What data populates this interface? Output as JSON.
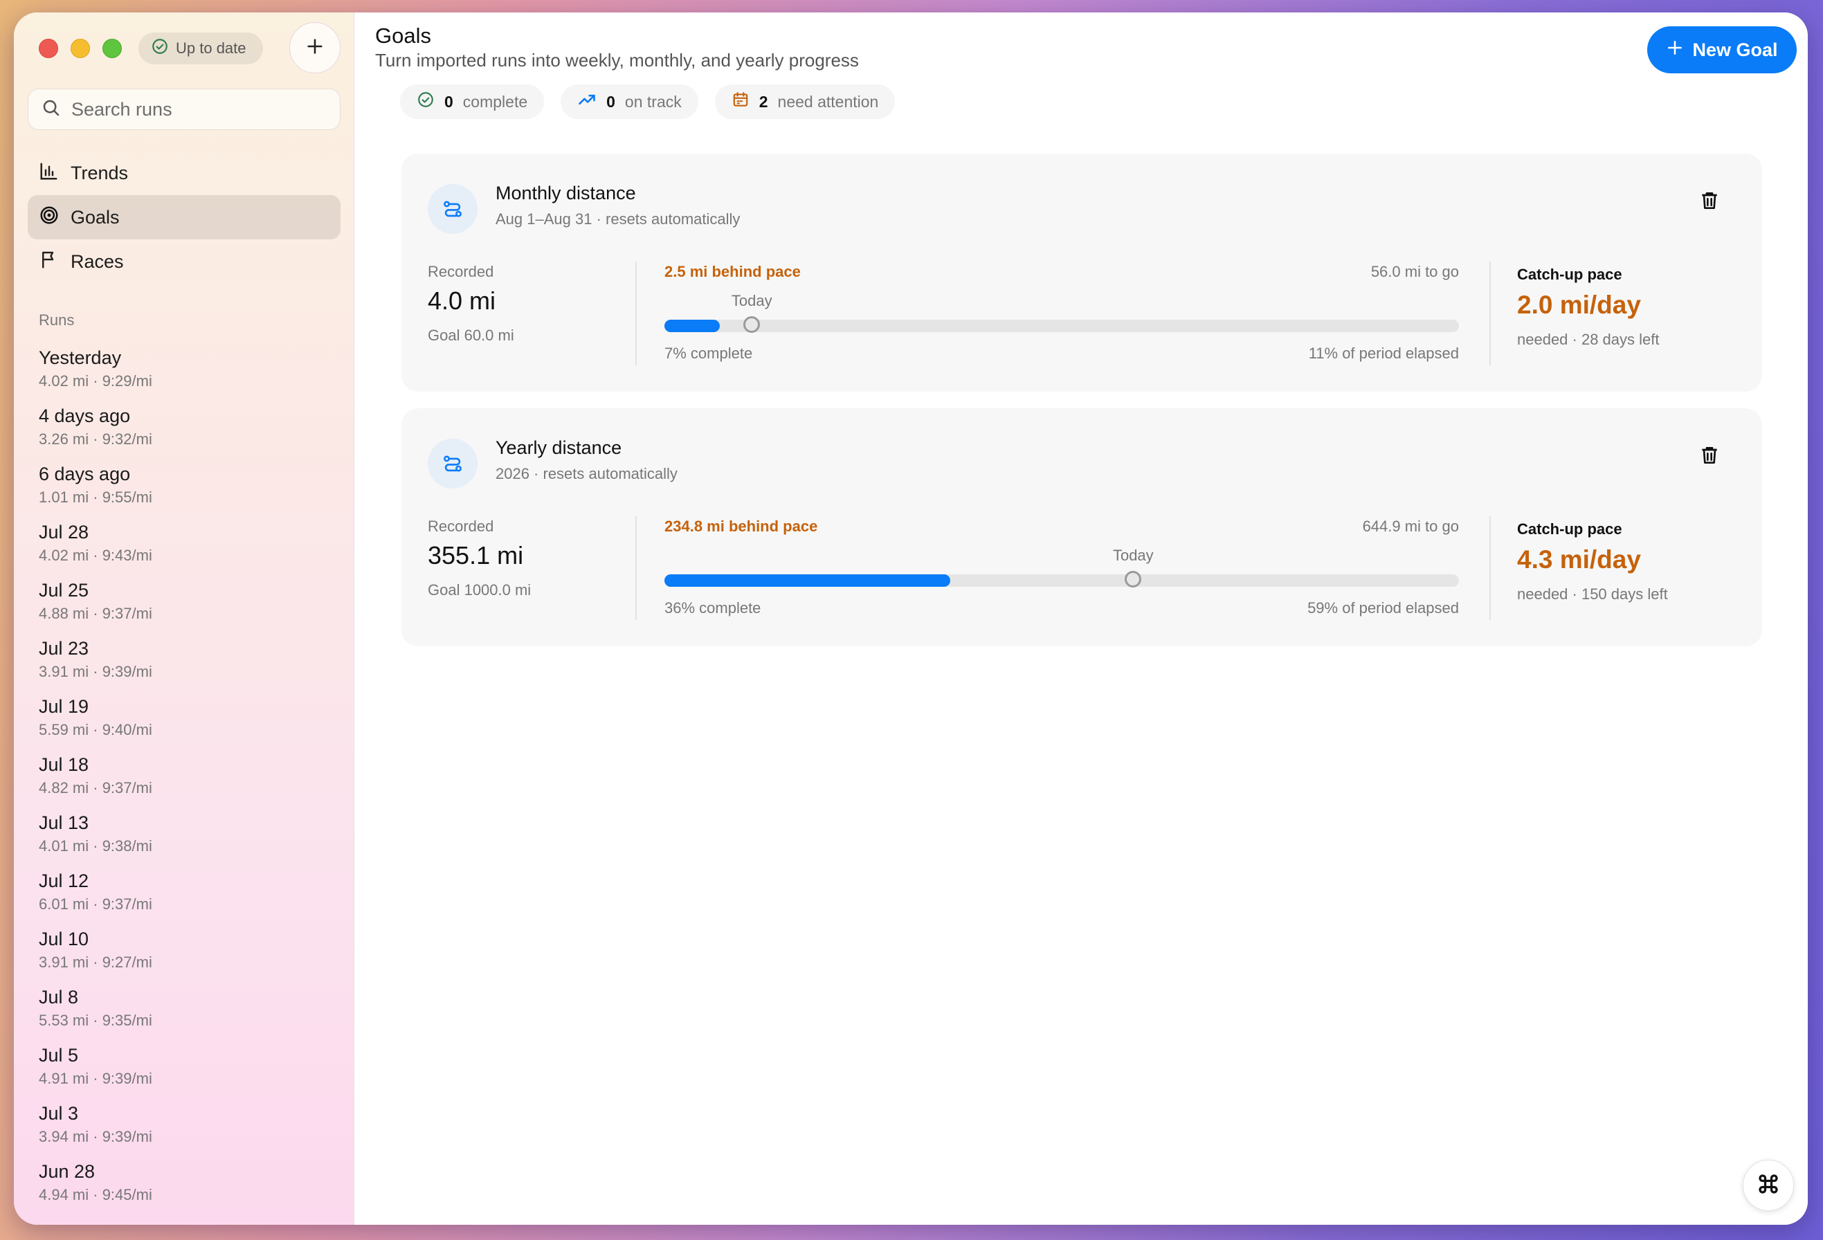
{
  "sidebar": {
    "status": "Up to date",
    "search_placeholder": "Search runs",
    "nav": [
      {
        "label": "Trends",
        "icon": "bar-chart-icon"
      },
      {
        "label": "Goals",
        "icon": "target-icon",
        "active": true
      },
      {
        "label": "Races",
        "icon": "flag-icon"
      }
    ],
    "runs_heading": "Runs",
    "runs": [
      {
        "title": "Yesterday",
        "detail": "4.02 mi · 9:29/mi"
      },
      {
        "title": "4 days ago",
        "detail": "3.26 mi · 9:32/mi"
      },
      {
        "title": "6 days ago",
        "detail": "1.01 mi · 9:55/mi"
      },
      {
        "title": "Jul 28",
        "detail": "4.02 mi · 9:43/mi"
      },
      {
        "title": "Jul 25",
        "detail": "4.88 mi · 9:37/mi"
      },
      {
        "title": "Jul 23",
        "detail": "3.91 mi · 9:39/mi"
      },
      {
        "title": "Jul 19",
        "detail": "5.59 mi · 9:40/mi"
      },
      {
        "title": "Jul 18",
        "detail": "4.82 mi · 9:37/mi"
      },
      {
        "title": "Jul 13",
        "detail": "4.01 mi · 9:38/mi"
      },
      {
        "title": "Jul 12",
        "detail": "6.01 mi · 9:37/mi"
      },
      {
        "title": "Jul 10",
        "detail": "3.91 mi · 9:27/mi"
      },
      {
        "title": "Jul 8",
        "detail": "5.53 mi · 9:35/mi"
      },
      {
        "title": "Jul 5",
        "detail": "4.91 mi · 9:39/mi"
      },
      {
        "title": "Jul 3",
        "detail": "3.94 mi · 9:39/mi"
      },
      {
        "title": "Jun 28",
        "detail": "4.94 mi · 9:45/mi"
      }
    ]
  },
  "header": {
    "title": "Goals",
    "subtitle": "Turn imported runs into weekly, monthly, and yearly progress",
    "new_goal_label": "New Goal"
  },
  "stats": [
    {
      "count": "0",
      "label": "complete",
      "icon": "check-circle-icon",
      "color": "#2e7d4f"
    },
    {
      "count": "0",
      "label": "on track",
      "icon": "trend-up-icon",
      "color": "#0a7cf7"
    },
    {
      "count": "2",
      "label": "need attention",
      "icon": "calendar-icon",
      "color": "#c5620b"
    }
  ],
  "goals": [
    {
      "title": "Monthly distance",
      "subtitle": "Aug 1–Aug 31 · resets automatically",
      "recorded_label": "Recorded",
      "recorded_value": "4.0 mi",
      "goal_text": "Goal 60.0 mi",
      "behind_text": "2.5 mi behind pace",
      "to_go_text": "56.0 mi to go",
      "today_label": "Today",
      "progress": 0.07,
      "elapsed": 0.11,
      "complete_text": "7% complete",
      "elapsed_text": "11% of period elapsed",
      "catchup_label": "Catch-up pace",
      "catchup_value": "2.0 mi/day",
      "catchup_sub": "needed · 28 days left"
    },
    {
      "title": "Yearly distance",
      "subtitle": "2026 · resets automatically",
      "recorded_label": "Recorded",
      "recorded_value": "355.1 mi",
      "goal_text": "Goal 1000.0 mi",
      "behind_text": "234.8 mi behind pace",
      "to_go_text": "644.9 mi to go",
      "today_label": "Today",
      "progress": 0.36,
      "elapsed": 0.59,
      "complete_text": "36% complete",
      "elapsed_text": "59% of period elapsed",
      "catchup_label": "Catch-up pace",
      "catchup_value": "4.3 mi/day",
      "catchup_sub": "needed · 150 days left"
    }
  ],
  "colors": {
    "accent": "#0a7cf7",
    "warning": "#c5620b"
  }
}
